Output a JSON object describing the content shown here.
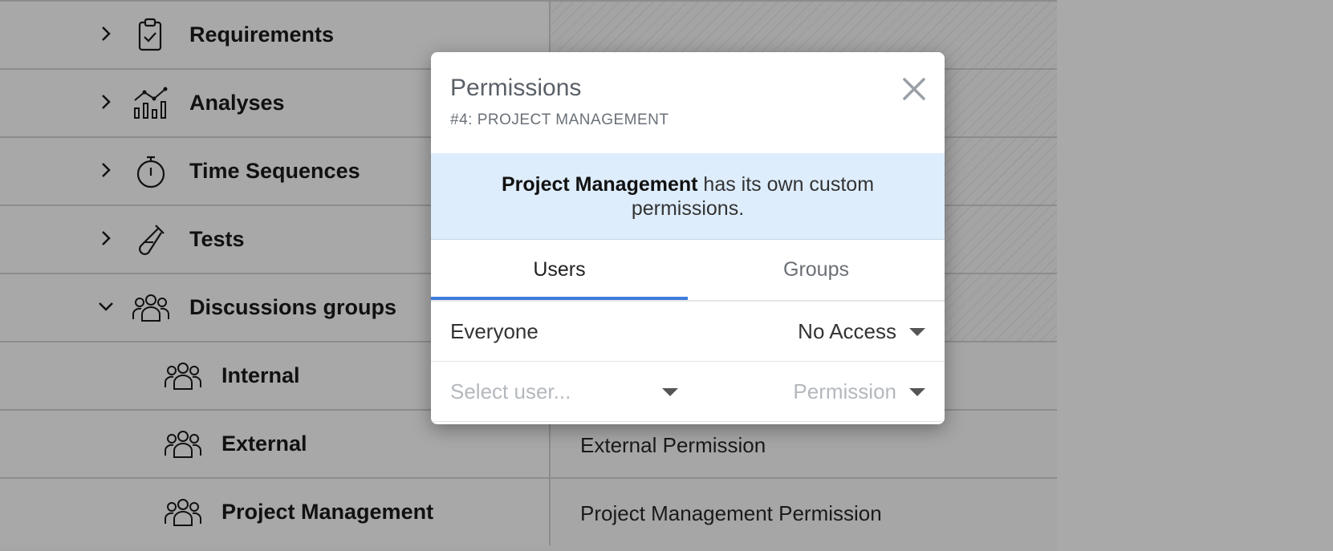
{
  "tree": {
    "rows": [
      {
        "label": "Requirements",
        "expanded": false,
        "icon": "clipboard-check-icon",
        "permission": ""
      },
      {
        "label": "Analyses",
        "expanded": false,
        "icon": "chart-analysis-icon",
        "permission": ""
      },
      {
        "label": "Time Sequences",
        "expanded": false,
        "icon": "stopwatch-icon",
        "permission": ""
      },
      {
        "label": "Tests",
        "expanded": false,
        "icon": "test-tube-icon",
        "permission": ""
      },
      {
        "label": "Discussions groups",
        "expanded": true,
        "icon": "people-icon",
        "permission": ""
      },
      {
        "label": "Internal",
        "icon": "people-icon",
        "permission": ""
      },
      {
        "label": "External",
        "icon": "people-icon",
        "permission": "External Permission"
      },
      {
        "label": "Project Management",
        "icon": "people-icon",
        "permission": "Project Management Permission"
      }
    ]
  },
  "modal": {
    "title": "Permissions",
    "subtitle": "#4: PROJECT MANAGEMENT",
    "notice_bold": "Project Management",
    "notice_rest": " has its own custom permissions.",
    "tabs": [
      {
        "label": "Users",
        "active": true
      },
      {
        "label": "Groups",
        "active": false
      }
    ],
    "everyone_label": "Everyone",
    "everyone_value": "No Access",
    "select_user_placeholder": "Select user...",
    "permission_placeholder": "Permission"
  },
  "colors": {
    "accent": "#3d7ddc",
    "notice_bg": "#deedfc",
    "overlay": "#a8a8a8"
  }
}
